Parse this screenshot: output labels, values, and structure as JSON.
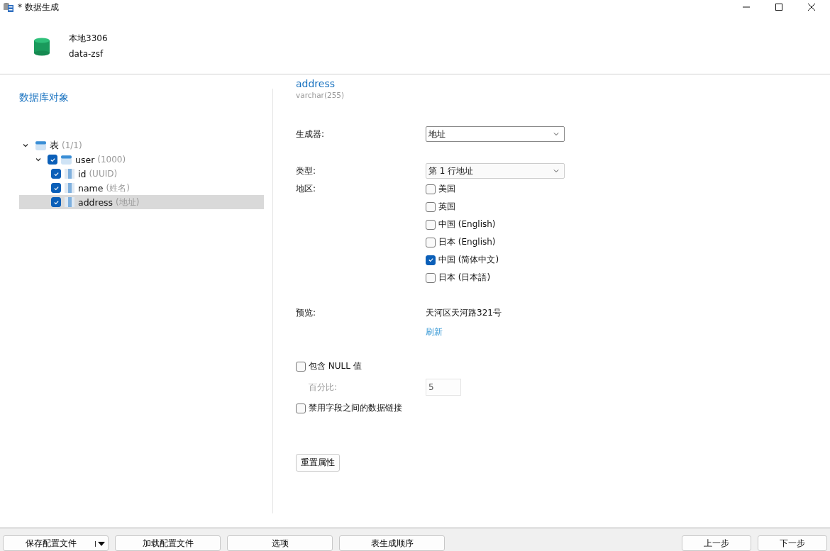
{
  "window": {
    "title": "* 数据生成"
  },
  "connection": {
    "name": "本地3306",
    "database": "data-zsf"
  },
  "sidebar": {
    "title": "数据库对象",
    "tree": [
      {
        "label": "表",
        "hint": "(1/1)",
        "kind": "group",
        "expanded": true,
        "selected": false,
        "children": [
          {
            "label": "user",
            "hint": "(1000)",
            "kind": "table",
            "checked": true,
            "expanded": true,
            "selected": false,
            "children": [
              {
                "label": "id",
                "hint": "(UUID)",
                "kind": "field",
                "checked": true,
                "selected": false
              },
              {
                "label": "name",
                "hint": "(姓名)",
                "kind": "field",
                "checked": true,
                "selected": false
              },
              {
                "label": "address",
                "hint": "(地址)",
                "kind": "field",
                "checked": true,
                "selected": true
              }
            ]
          }
        ]
      }
    ]
  },
  "field": {
    "name": "address",
    "type": "varchar(255)"
  },
  "generator": {
    "label": "生成器:",
    "value": "地址"
  },
  "type": {
    "label": "类型:",
    "value": "第 1 行地址"
  },
  "region": {
    "label": "地区:",
    "options": [
      {
        "label": "美国",
        "checked": false
      },
      {
        "label": "英国",
        "checked": false
      },
      {
        "label": "中国 (English)",
        "checked": false
      },
      {
        "label": "日本 (English)",
        "checked": false
      },
      {
        "label": "中国 (简体中文)",
        "checked": true
      },
      {
        "label": "日本 (日本語)",
        "checked": false
      }
    ]
  },
  "preview": {
    "label": "预览:",
    "value": "天河区天河路321号",
    "refresh": "刷新"
  },
  "include_null": {
    "label": "包含 NULL 值",
    "checked": false
  },
  "percent": {
    "label": "百分比:",
    "value": "5",
    "disabled": true
  },
  "disable_links": {
    "label": "禁用字段之间的数据链接",
    "checked": false
  },
  "reset_button": "重置属性",
  "footer": {
    "left": [
      "保存配置文件",
      "加载配置文件",
      "选项",
      "表生成顺序"
    ],
    "right": [
      "上一步",
      "下一步"
    ]
  }
}
